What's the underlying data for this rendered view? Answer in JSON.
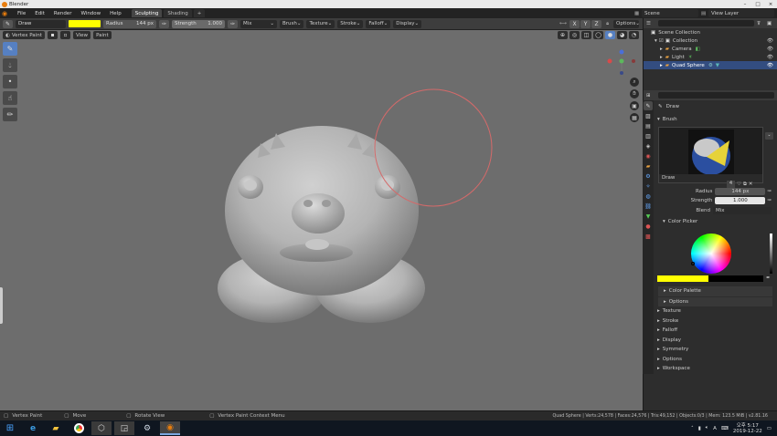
{
  "app": {
    "title": "Blender"
  },
  "menu": {
    "items": [
      "File",
      "Edit",
      "Render",
      "Window",
      "Help"
    ],
    "tabs": [
      "Sculpting",
      "Shading"
    ],
    "add_tab": "+"
  },
  "scene": {
    "name": "Scene",
    "view_layer": "View Layer"
  },
  "toolbar": {
    "brush_name": "Draw",
    "color": "#ffff00",
    "radius_label": "Radius",
    "radius_value": "144 px",
    "strength_label": "Strength",
    "strength_value": "1.000",
    "blend": "Mix",
    "menus": [
      "Brush",
      "Texture",
      "Stroke",
      "Falloff",
      "Display"
    ],
    "axes": [
      "X",
      "Y",
      "Z"
    ],
    "options": "Options"
  },
  "viewport": {
    "mode": "Vertex Paint",
    "view_menu": "View",
    "paint_menu": "Paint",
    "bg": "#6d6d6d",
    "model_color": "#b8b8b8",
    "cursor_color": "#d46a6a"
  },
  "outliner": {
    "root": "Scene Collection",
    "collection": "Collection",
    "items": [
      "Camera",
      "Light",
      "Quad Sphere"
    ]
  },
  "properties": {
    "tool_name": "Draw",
    "brush_section": "Brush",
    "brush_preview_name": "Draw",
    "brush_users": "4",
    "radius_label": "Radius",
    "radius_value": "144 px",
    "strength_label": "Strength",
    "strength_value": "1.000",
    "blend_label": "Blend",
    "blend_value": "Mix",
    "color_picker": "Color Picker",
    "color_palette": "Color Palette",
    "options_sub": "Options",
    "sections": [
      "Texture",
      "Stroke",
      "Falloff",
      "Display",
      "Symmetry",
      "Options",
      "Workspace"
    ]
  },
  "status": {
    "left": [
      "Vertex Paint",
      "Move",
      "Rotate View",
      "Vertex Paint Context Menu"
    ],
    "right": "Quad Sphere | Verts:24,578 | Faces:24,576 | Tris:49,152 | Objects:0/3 | Mem: 123.5 MiB | v2.81.16"
  },
  "taskbar": {
    "icons": [
      "start-icon",
      "ie-icon",
      "explorer-icon",
      "chrome-icon",
      "app-icon",
      "steam-window-icon",
      "steam-icon",
      "blender-icon"
    ],
    "time": "오후 5:17",
    "date": "2019-12-22"
  },
  "colors": {
    "accent": "#5680c2",
    "selected_row": "#334d80",
    "yellow": "#ffff00"
  }
}
